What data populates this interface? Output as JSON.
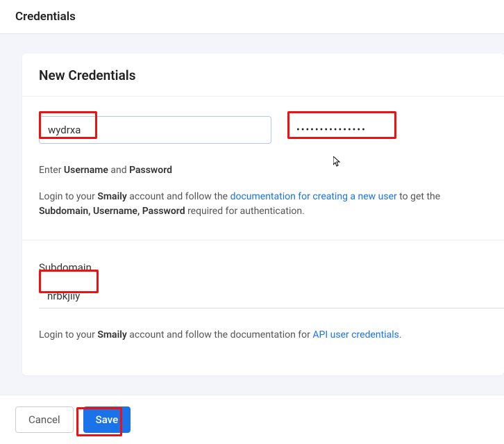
{
  "page": {
    "title": "Credentials"
  },
  "card": {
    "title": "New Credentials"
  },
  "fields": {
    "username": {
      "value": "wydrxa"
    },
    "password": {
      "masked": "•••••••••••••••"
    },
    "subdomain": {
      "label": "Subdomain",
      "value": "nrbkjiiy"
    }
  },
  "hints": {
    "enter_prefix": "Enter ",
    "username_word": "Username",
    "and_word": " and ",
    "password_word": "Password",
    "help1_prefix": "Login to your ",
    "smaily": "Smaily",
    "help1_mid": " account and follow the ",
    "doc_link": "documentation for creating a new user",
    "help1_after_link": " to get the ",
    "subdomain_word": "Subdomain, Username,",
    "help1_pw_prefix": " ",
    "help1_suffix": " required for authentication.",
    "help2_prefix": "Login to your ",
    "help2_mid": " account and follow the documentation for ",
    "api_link": "API user credentials",
    "help2_suffix": "."
  },
  "buttons": {
    "cancel": "Cancel",
    "save": "Save"
  }
}
